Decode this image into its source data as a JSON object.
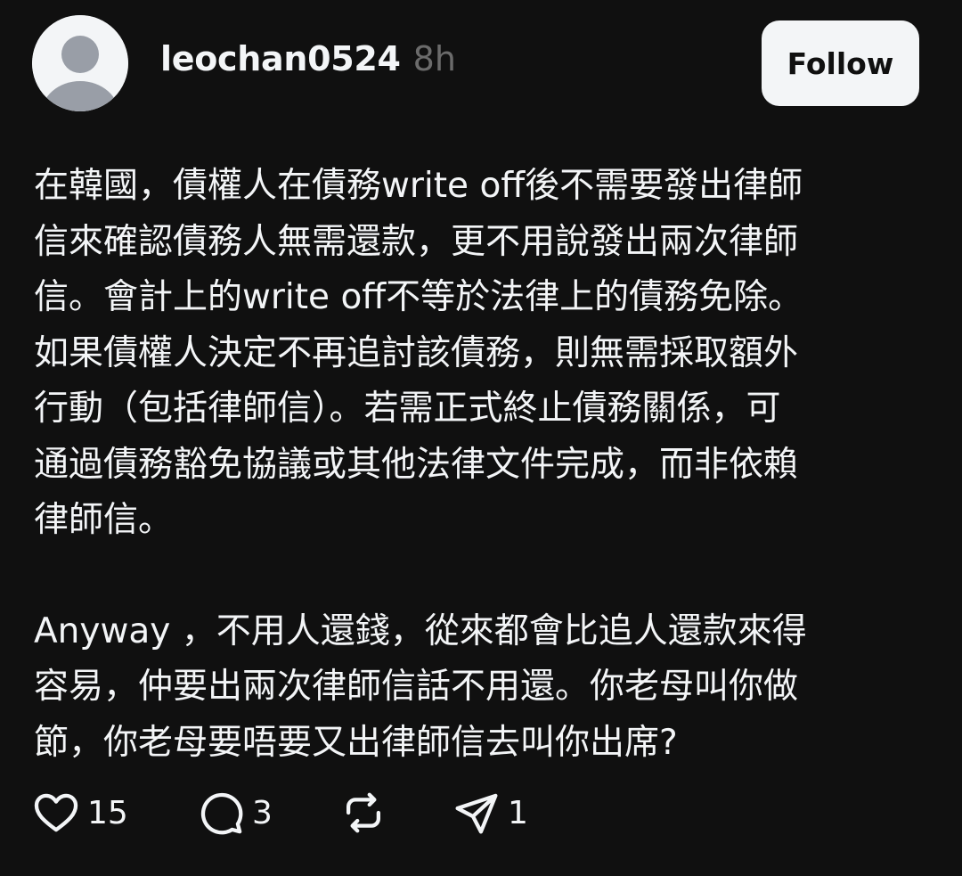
{
  "post": {
    "author": {
      "username": "leochan0524",
      "avatar_icon": "default-avatar-icon"
    },
    "timestamp": "8h",
    "follow_label": "Follow",
    "paragraphs": [
      "在韓國，債權人在債務write off後不需要發出律師\n信來確認債務人無需還款，更不用說發出兩次律師\n信。會計上的write off不等於法律上的債務免除。\n如果債權人決定不再追討該債務，則無需採取額外\n行動（包括律師信）。若需正式終止債務關係，可\n通過債務豁免協議或其他法律文件完成，而非依賴\n律師信。",
      "Anyway ，不用人還錢，從來都會比追人還款來得\n容易，仲要出兩次律師信話不用還。你老母叫你做\n節，你老母要唔要又出律師信去叫你出席?"
    ],
    "actions": {
      "like": {
        "icon": "heart-icon",
        "count": "15"
      },
      "reply": {
        "icon": "comment-icon",
        "count": "3"
      },
      "repost": {
        "icon": "repost-icon",
        "count": ""
      },
      "share": {
        "icon": "send-icon",
        "count": "1"
      }
    }
  },
  "colors": {
    "background": "#101010",
    "text": "#f3f5f7",
    "muted": "#6b6b6b",
    "button_bg": "#f3f5f7",
    "button_text": "#101010"
  }
}
